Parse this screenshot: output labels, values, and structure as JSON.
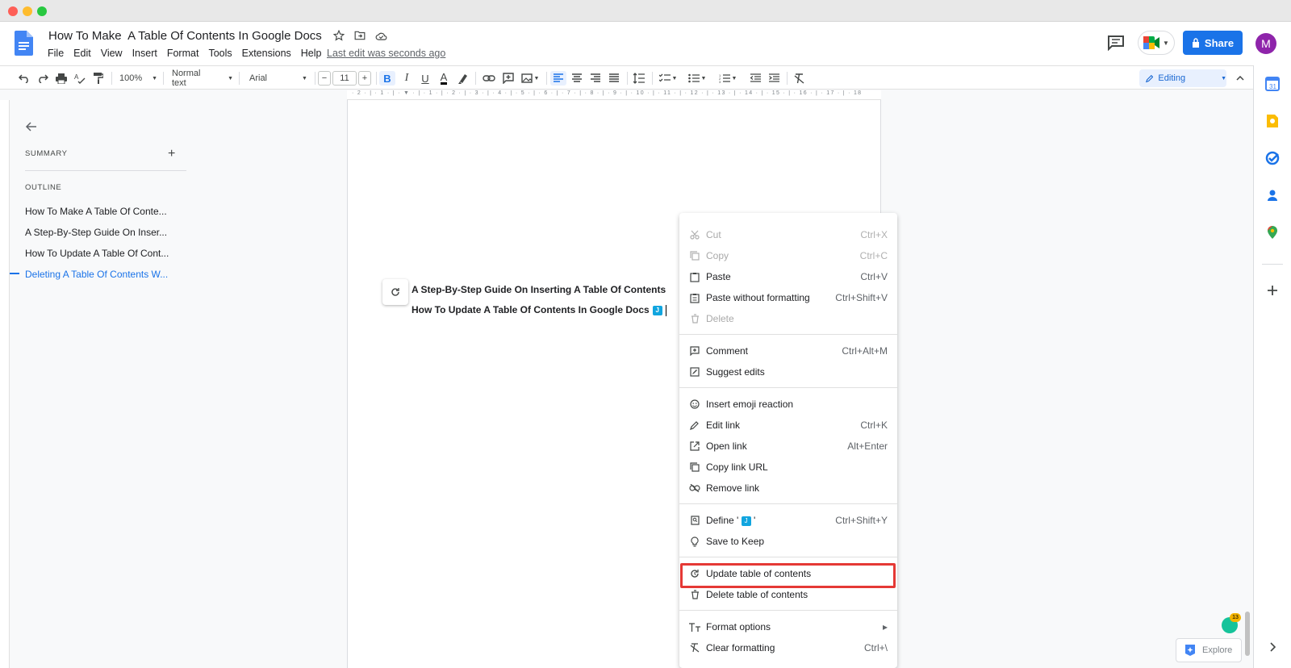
{
  "header": {
    "doc_title": "How To Make  A Table Of Contents In Google Docs",
    "menu": [
      "File",
      "Edit",
      "View",
      "Insert",
      "Format",
      "Tools",
      "Extensions",
      "Help"
    ],
    "last_edit": "Last edit was seconds ago",
    "share_label": "Share",
    "avatar_letter": "M"
  },
  "toolbar": {
    "zoom": "100%",
    "style": "Normal text",
    "font": "Arial",
    "font_size": "11",
    "editing_mode": "Editing"
  },
  "ruler": {
    "ticks": "· 2 · | · 1 · | · ▼ · | · 1 · | · 2 · | · 3 · | · 4 · | · 5 · | · 6 · | · 7 · | · 8 · | · 9 · | · 10 · | · 11 · | · 12 · | · 13 · | · 14 · | · 15 · | · 16 · | · 17 · | · 18"
  },
  "outline": {
    "summary_label": "SUMMARY",
    "outline_label": "OUTLINE",
    "items": [
      {
        "label": "How To Make A Table Of Conte..."
      },
      {
        "label": "A Step-By-Step Guide On Inser..."
      },
      {
        "label": "How To Update A Table Of Cont..."
      },
      {
        "label": "Deleting A Table Of Contents W..."
      }
    ]
  },
  "document": {
    "toc_line_1": "A Step-By-Step Guide On Inserting A Table Of Contents",
    "toc_line_2": "How To Update A Table Of Contents In Google Docs",
    "chip_glyph": "J"
  },
  "context_menu": {
    "items": [
      {
        "label": "Cut",
        "shortcut": "Ctrl+X",
        "icon": "scissors-icon",
        "disabled": true
      },
      {
        "label": "Copy",
        "shortcut": "Ctrl+C",
        "icon": "copy-icon",
        "disabled": true
      },
      {
        "label": "Paste",
        "shortcut": "Ctrl+V",
        "icon": "clipboard-icon",
        "disabled": false
      },
      {
        "label": "Paste without formatting",
        "shortcut": "Ctrl+Shift+V",
        "icon": "clipboard-text-icon",
        "disabled": false
      },
      {
        "label": "Delete",
        "shortcut": "",
        "icon": "trash-icon",
        "disabled": true
      },
      {
        "label": "Comment",
        "shortcut": "Ctrl+Alt+M",
        "icon": "comment-add-icon",
        "disabled": false
      },
      {
        "label": "Suggest edits",
        "shortcut": "",
        "icon": "suggest-edit-icon",
        "disabled": false
      },
      {
        "label": "Insert emoji reaction",
        "shortcut": "",
        "icon": "emoji-icon",
        "disabled": false
      },
      {
        "label": "Edit link",
        "shortcut": "Ctrl+K",
        "icon": "pencil-icon",
        "disabled": false
      },
      {
        "label": "Open link",
        "shortcut": "Alt+Enter",
        "icon": "open-external-icon",
        "disabled": false
      },
      {
        "label": "Copy link URL",
        "shortcut": "",
        "icon": "copy-link-icon",
        "disabled": false
      },
      {
        "label": "Remove link",
        "shortcut": "",
        "icon": "link-off-icon",
        "disabled": false
      },
      {
        "label": "Define ' ",
        "label_suffix": " '",
        "shortcut": "Ctrl+Shift+Y",
        "icon": "dictionary-icon",
        "disabled": false
      },
      {
        "label": "Save to Keep",
        "shortcut": "",
        "icon": "lightbulb-icon",
        "disabled": false
      },
      {
        "label": "Update table of contents",
        "shortcut": "",
        "icon": "refresh-icon",
        "disabled": false
      },
      {
        "label": "Delete table of contents",
        "shortcut": "",
        "icon": "trash-icon",
        "disabled": false
      },
      {
        "label": "Format options",
        "shortcut": "▸",
        "icon": "text-format-icon",
        "disabled": false
      },
      {
        "label": "Clear formatting",
        "shortcut": "Ctrl+\\",
        "icon": "clear-format-icon",
        "disabled": false
      }
    ]
  },
  "bottom": {
    "explore_label": "Explore",
    "grammarly_count": "13"
  },
  "colors": {
    "accent": "#1a73e8",
    "highlight": "#e53935"
  }
}
